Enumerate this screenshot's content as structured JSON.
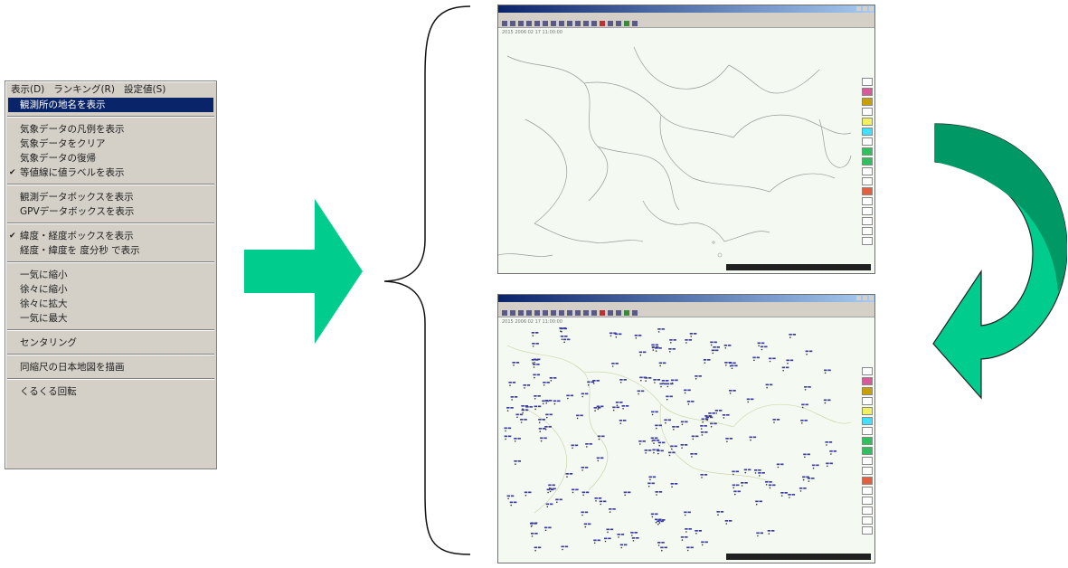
{
  "menu": {
    "bar": [
      "表示(D)",
      "ランキング(R)",
      "設定値(S)"
    ],
    "groups": [
      [
        {
          "label": "観測所の地名を表示",
          "highlighted": true
        }
      ],
      [
        {
          "label": "気象データの凡例を表示"
        },
        {
          "label": "気象データをクリア"
        },
        {
          "label": "気象データの復帰"
        },
        {
          "label": "等値線に値ラベルを表示",
          "checked": true
        }
      ],
      [
        {
          "label": "観測データボックスを表示"
        },
        {
          "label": "GPVデータボックスを表示"
        }
      ],
      [
        {
          "label": "緯度・経度ボックスを表示",
          "checked": true
        },
        {
          "label": "経度・緯度を 度分秒 で表示"
        }
      ],
      [
        {
          "label": "一気に縮小"
        },
        {
          "label": "徐々に縮小"
        },
        {
          "label": "徐々に拡大"
        },
        {
          "label": "一気に最大"
        }
      ],
      [
        {
          "label": "センタリング"
        }
      ],
      [
        {
          "label": "同縮尺の日本地図を描画"
        }
      ],
      [
        {
          "label": "くるくる回転"
        }
      ]
    ]
  },
  "colors": {
    "arrow_fill": "#00cc8e",
    "curve_dark": "#009966",
    "highlight_bg": "#0a246a",
    "station_label": "#3a3aa0"
  },
  "screenshots": [
    {
      "title_time": "2015 2006 02 17 11:00:00",
      "labels": false
    },
    {
      "title_time": "2015 2006 02 17 11:00:00",
      "labels": true
    }
  ],
  "legend_colors": [
    "#ffffff",
    "#d85a9a",
    "#c8a000",
    "#ffffff",
    "#f0f060",
    "#40e0ff",
    "#ffffff",
    "#30c060",
    "#30c060",
    "#ffffff",
    "#ffffff",
    "#e06040",
    "#ffffff",
    "#ffffff",
    "#ffffff",
    "#ffffff",
    "#ffffff"
  ]
}
